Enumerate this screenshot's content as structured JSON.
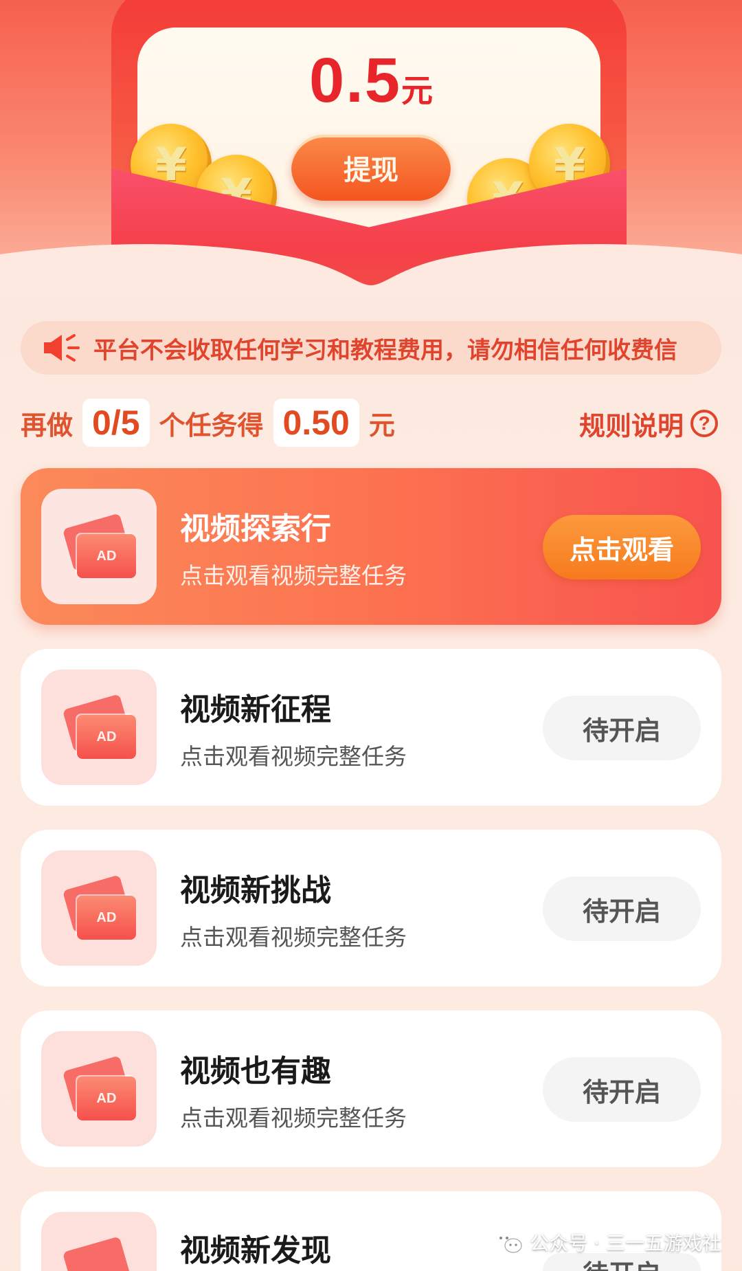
{
  "reward": {
    "amount": "0.5",
    "unit": "元",
    "withdraw_label": "提现"
  },
  "notice": {
    "text": "平台不会收取任何学习和教程费用，请勿相信任何收费信"
  },
  "progress": {
    "prefix": "再做",
    "done": "0/5",
    "middle": "个任务得",
    "reward": "0.50",
    "suffix": "元",
    "rules_label": "规则说明",
    "help_glyph": "?"
  },
  "coin_glyph": "¥",
  "ad_label": "AD",
  "tasks": [
    {
      "title": "视频探索行",
      "subtitle": "点击观看视频完整任务",
      "button": "点击观看"
    },
    {
      "title": "视频新征程",
      "subtitle": "点击观看视频完整任务",
      "button": "待开启"
    },
    {
      "title": "视频新挑战",
      "subtitle": "点击观看视频完整任务",
      "button": "待开启"
    },
    {
      "title": "视频也有趣",
      "subtitle": "点击观看视频完整任务",
      "button": "待开启"
    },
    {
      "title": "视频新发现",
      "subtitle": "",
      "button": "待开启"
    }
  ],
  "watermark": {
    "text": "公众号 · 三一五游戏社"
  },
  "colors": {
    "accent": "#e8252a",
    "primary_button": "#f77a1e",
    "notice_text": "#e0442d"
  }
}
